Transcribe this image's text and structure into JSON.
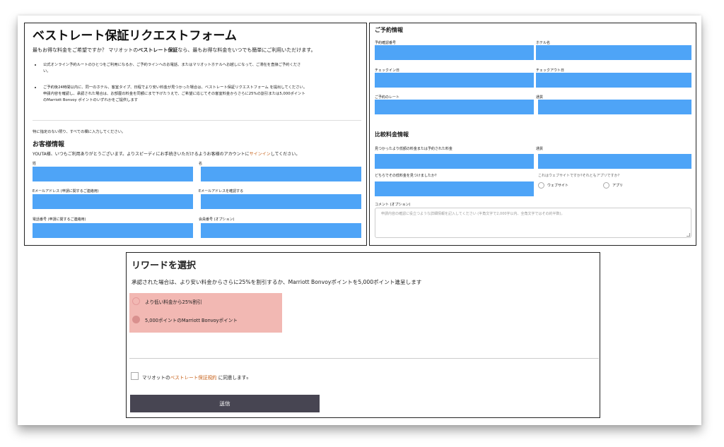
{
  "left_panel": {
    "title": "ベストレート保証リクエストフォーム",
    "intro_pre": "最もお得な料金をご希望ですか？ マリオットの",
    "intro_bold": "ベストレート保証",
    "intro_post": "なら、最もお得な料金をいつでも簡単にご利用いただけます。",
    "bullet1_line1": "公式オンライン予約ルートのひとつをご利用になるか、ご予約ラインへのお電話、またはマリオットホテルへお越しになって、ご滞在を直接ご予約くださ",
    "bullet1_line2": "い。",
    "bullet2_line1": "ご予約後24時間以内に、同一のホテル、客室タイプ、日程でより安い料金が見つかった場合は、ベストレート保証リクエストフォーム を提出してください。",
    "bullet2_line2": "申請内容を確認し、承認された場合は、お部屋の料金を同額にまで下げたうえで、ご希望に応じてその客室料金からさらに25%の割引または5,000ポイント",
    "bullet2_line3": "のMarriott Bonvoy ポイントのいずれかをご提供します",
    "required_note": "特に指定のない限り、すべての欄に入力してください。",
    "guest_heading": "お客様情報",
    "guest_msg_pre": "YOUTA様、いつもご利用ありがとうございます。よりスピーディにお手続きいただけるようお客様のアカウントに",
    "guest_msg_link": "サインイン",
    "guest_msg_post": "してください。",
    "label_last": "姓",
    "label_first": "名",
    "label_email": "Eメールアドレス (申請に関するご連絡用)",
    "label_email_confirm": "Eメールアドレスを確認する",
    "label_phone": "電話番号 (申請に関するご連絡用)",
    "label_member": "会員番号 (オプション)"
  },
  "right_panel": {
    "reservation_heading": "ご予約情報",
    "label_conf": "予約確認番号",
    "label_hotel": "ホテル名",
    "label_checkin": "チェックイン日",
    "label_checkout": "チェックアウト日",
    "label_rate": "ご予約のレート",
    "label_currency1": "通貨",
    "compare_heading": "比較料金情報",
    "label_found_rate": "見つかったより低額の料金または予約された料金",
    "label_currency2": "通貨",
    "label_where": "どちらでその低料金を見つけましたか?",
    "label_web_or_app": "これはウェブサイトですか?それともアプリですか?",
    "option_website": "ウェブサイト",
    "option_app": "アプリ",
    "label_comment": "コメント (オプション)",
    "comment_placeholder": "申請内容の確認に役立つような詳細情報を記入してください (半角文字で2,000字以内、全角文字ではその約半数)。"
  },
  "reward_panel": {
    "heading": "リワードを選択",
    "description": "承認された場合は、より安い料金からさらに25%を割引するか、Marriott Bonvoyポイントを5,000ポイント進呈します",
    "option_discount": "より低い料金から25%割引",
    "option_points": "5,000ポイントのMarriott Bonvoyポイント",
    "agree_pre": "マリオットの",
    "agree_link": "ベストレート保証規約",
    "agree_post": " に同意します",
    "submit_label": "送信"
  },
  "colors": {
    "field_blue": "#4ea4f7",
    "link_orange": "#c8641e",
    "highlight_pink": "#f2b8b3",
    "button_dark": "#474552"
  }
}
